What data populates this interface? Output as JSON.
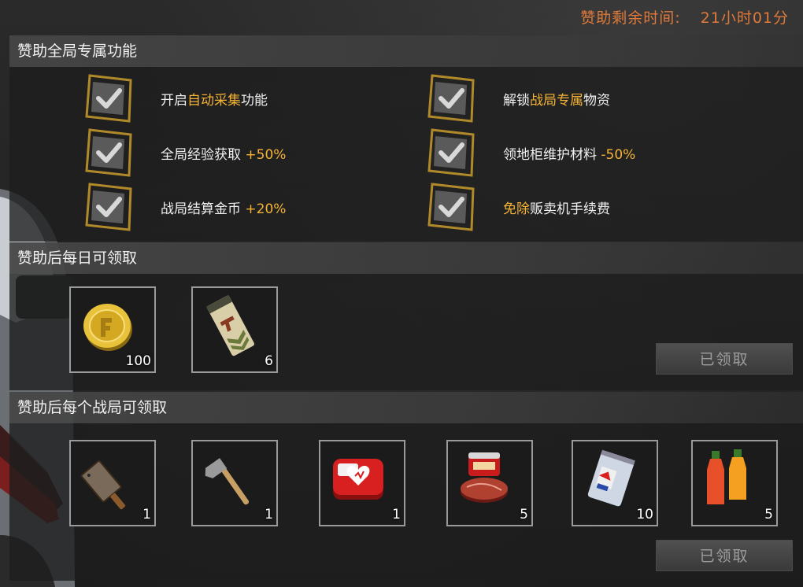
{
  "timer": {
    "label": "赞助剩余时间:",
    "value": "21小时01分"
  },
  "sections": {
    "global": {
      "title": "赞助全局专属功能"
    },
    "daily": {
      "title": "赞助后每日可领取",
      "claim_label": "已领取"
    },
    "per_match": {
      "title": "赞助后每个战局可领取",
      "claim_label": "已领取"
    }
  },
  "features": [
    {
      "pre": "开启",
      "hl": "自动采集",
      "post": "功能"
    },
    {
      "pre": "解锁",
      "hl": "战局专属",
      "post": "物资"
    },
    {
      "pre": "全局经验获取 ",
      "hl": "+50%",
      "post": ""
    },
    {
      "pre": "领地柜维护材料 ",
      "hl": "-50%",
      "post": ""
    },
    {
      "pre": "战局结算金币 ",
      "hl": "+20%",
      "post": ""
    },
    {
      "pre": "",
      "hl": "免除",
      "post": "贩卖机手续费"
    }
  ],
  "daily_items": [
    {
      "icon": "gold-coin-icon",
      "count": "100"
    },
    {
      "icon": "weapon-card-icon",
      "count": "6"
    }
  ],
  "match_items": [
    {
      "icon": "cleaver-icon",
      "count": "1"
    },
    {
      "icon": "hatchet-icon",
      "count": "1"
    },
    {
      "icon": "first-aid-kit-icon",
      "count": "1"
    },
    {
      "icon": "canned-meat-icon",
      "count": "5"
    },
    {
      "icon": "food-bag-icon",
      "count": "10"
    },
    {
      "icon": "juice-bottles-icon",
      "count": "5"
    }
  ],
  "colors": {
    "accent": "#f5b335",
    "timer": "#e07a3a"
  }
}
